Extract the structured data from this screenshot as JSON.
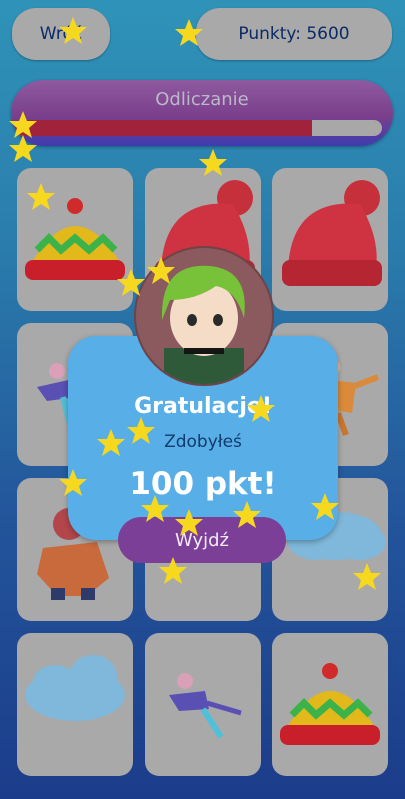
{
  "header": {
    "back_label": "Wróć",
    "score_label": "Punkty: 5600"
  },
  "timer": {
    "label": "Odliczanie",
    "progress": 0.81
  },
  "grid": {
    "cards": [
      "winter-hat-yellow",
      "knit-hat-red",
      "knit-hat-red",
      "ice-skater",
      "hidden",
      "ice-skater",
      "child-snowsuit",
      "hidden",
      "cloud",
      "cloud",
      "ice-skater",
      "winter-hat-yellow"
    ]
  },
  "dialog": {
    "title": "Gratulacje!",
    "subtitle": "Zdobyłeś",
    "points": "100 pkt!",
    "exit_label": "Wyjdź"
  },
  "colors": {
    "accent_purple": "#7b3f97",
    "dialog_blue": "#58aee6",
    "star_yellow": "#f6d81e",
    "progress_red": "#a0233b"
  }
}
